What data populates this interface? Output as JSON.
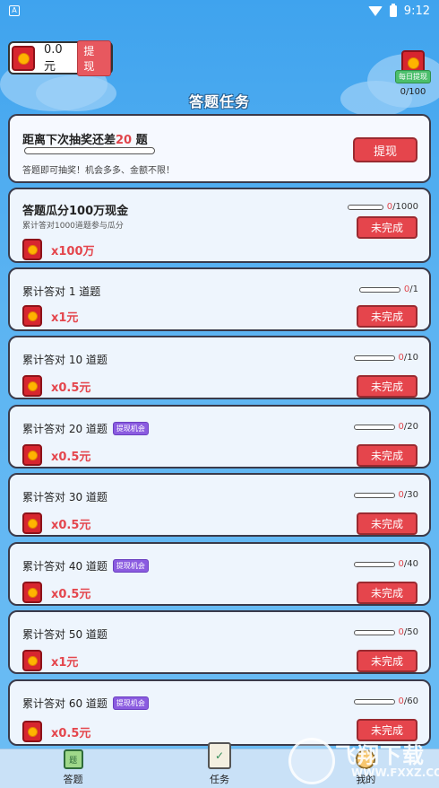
{
  "status": {
    "time": "9:12"
  },
  "balance": {
    "amount": "0.0元",
    "withdraw_label": "提现"
  },
  "daily": {
    "label": "每日提现",
    "count": "0/100"
  },
  "page_title": "答题任务",
  "lottery": {
    "prefix": "距离下次抽奖还差",
    "count": "20",
    "suffix": "题",
    "subtitle": "答题即可抽奖！机会多多、金额不限！",
    "button": "提现",
    "progress": 0
  },
  "tasks": [
    {
      "title": "答题瓜分100万现金",
      "desc": "累计答对1000道题参与瓜分",
      "badge": "",
      "reward": "x100万",
      "current": "0",
      "total": "/1000",
      "progress": 0,
      "button": "未完成"
    },
    {
      "title": "累计答对 1 道题",
      "desc": "",
      "badge": "",
      "reward": "x1元",
      "current": "0",
      "total": "/1",
      "progress": 0,
      "button": "未完成"
    },
    {
      "title": "累计答对 10 道题",
      "desc": "",
      "badge": "",
      "reward": "x0.5元",
      "current": "0",
      "total": "/10",
      "progress": 0,
      "button": "未完成"
    },
    {
      "title": "累计答对 20 道题",
      "desc": "",
      "badge": "提现机会",
      "reward": "x0.5元",
      "current": "0",
      "total": "/20",
      "progress": 0,
      "button": "未完成"
    },
    {
      "title": "累计答对 30 道题",
      "desc": "",
      "badge": "",
      "reward": "x0.5元",
      "current": "0",
      "total": "/30",
      "progress": 0,
      "button": "未完成"
    },
    {
      "title": "累计答对 40 道题",
      "desc": "",
      "badge": "提现机会",
      "reward": "x0.5元",
      "current": "0",
      "total": "/40",
      "progress": 0,
      "button": "未完成"
    },
    {
      "title": "累计答对 50 道题",
      "desc": "",
      "badge": "",
      "reward": "x1元",
      "current": "0",
      "total": "/50",
      "progress": 0,
      "button": "未完成"
    },
    {
      "title": "累计答对 60 道题",
      "desc": "",
      "badge": "提现机会",
      "reward": "x0.5元",
      "current": "0",
      "total": "/60",
      "progress": 0,
      "button": "未完成"
    }
  ],
  "nav": {
    "answer": "答题",
    "answer_icon_text": "题",
    "task": "任务",
    "me": "我的"
  },
  "watermark": {
    "text": "飞翔下载",
    "url": "WWW.FXXZ.COM"
  },
  "colors": {
    "accent": "#e5454c",
    "background": "#5cb4f2",
    "badge": "#8b5ce0",
    "daily": "#4cbf6c"
  }
}
